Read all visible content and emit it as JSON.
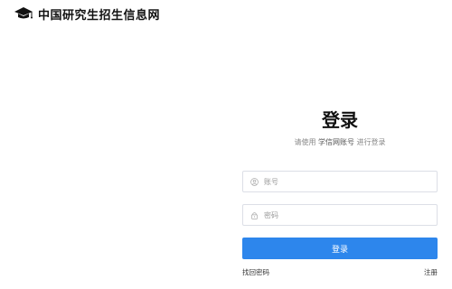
{
  "header": {
    "site_name": "中国研究生招生信息网"
  },
  "login": {
    "title": "登录",
    "subtitle_prefix": "请使用",
    "subtitle_account": "学信网账号",
    "subtitle_suffix": "进行登录",
    "account_placeholder": "账号",
    "password_placeholder": "密码",
    "login_button": "登录",
    "forgot_password": "找回密码",
    "register": "注册"
  },
  "colors": {
    "primary_button": "#2d86ec",
    "input_border": "#dcdfe6"
  },
  "icons": {
    "logo": "graduation-cap-icon",
    "account_field": "user-icon",
    "password_field": "lock-icon"
  }
}
